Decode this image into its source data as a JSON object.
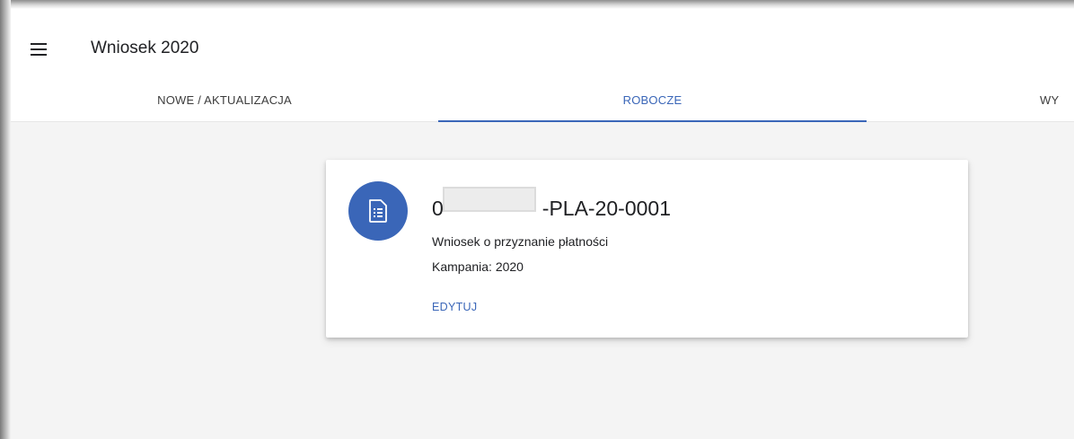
{
  "header": {
    "menu_icon": "hamburger-menu-icon",
    "title": "Wniosek 2020"
  },
  "tabs": [
    {
      "label": "NOWE / AKTUALIZACJA",
      "active": false
    },
    {
      "label": "ROBOCZE",
      "active": true
    },
    {
      "label": "WY",
      "active": false
    }
  ],
  "card": {
    "icon": "document-list-icon",
    "id_prefix": "0",
    "id_suffix": "-PLA-20-0001",
    "description": "Wniosek o przyznanie płatności",
    "campaign": "Kampania: 2020",
    "edit_label": "EDYTUJ"
  },
  "colors": {
    "accent": "#3a66b8",
    "background": "#f4f4f4",
    "card": "#ffffff"
  }
}
